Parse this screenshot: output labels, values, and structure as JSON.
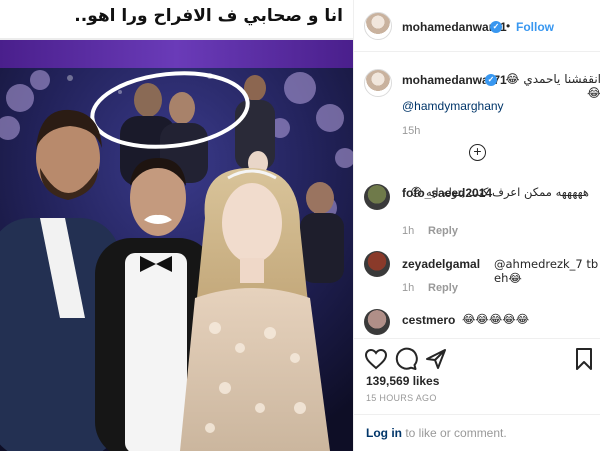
{
  "post": {
    "caption_overlay": "انا و صحابي ف الافراح ورا اهو.."
  },
  "header": {
    "username": "mohamedanwar71",
    "verified_mark": "✓",
    "separator": "•",
    "follow_label": "Follow"
  },
  "caption": {
    "username": "mohamedanwar71",
    "text": "انقفشنا ياحمدي 😂😂",
    "mention": "@hamdymarghany",
    "time": "15h"
  },
  "comments": [
    {
      "username": "fofo_saeed2014",
      "text": "هههههه ممكن اعرف كنت بتوله ايه 😐",
      "time": "1h",
      "reply_label": "Reply",
      "avatar_color": "#6f7a4a"
    },
    {
      "username": "zeyadelgamal",
      "text": "@ahmedrezk_7 tb eh😂",
      "time": "1h",
      "reply_label": "Reply",
      "avatar_color": "#8a3a2a"
    },
    {
      "username": "cestmero",
      "text": "😂😂😂😂😂",
      "avatar_color": "#b08f88"
    }
  ],
  "actions": {
    "icons": [
      "heart-icon",
      "comment-icon",
      "share-icon",
      "bookmark-icon"
    ],
    "likes": "139,569 likes",
    "ago": "15 HOURS AGO"
  },
  "login": {
    "link": "Log in",
    "rest": " to like or comment."
  }
}
